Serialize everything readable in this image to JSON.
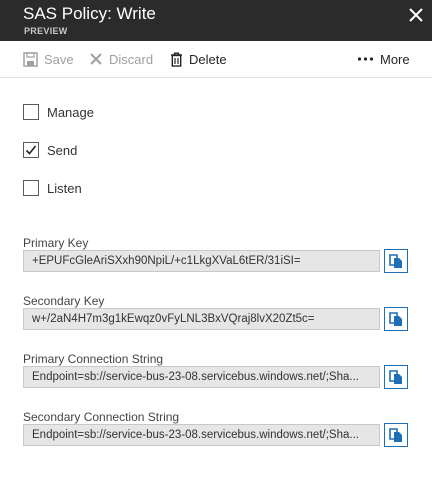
{
  "header": {
    "title": "SAS Policy: Write",
    "subtitle": "PREVIEW"
  },
  "toolbar": {
    "save": "Save",
    "discard": "Discard",
    "delete": "Delete",
    "more": "More"
  },
  "claims": [
    {
      "label": "Manage",
      "checked": false
    },
    {
      "label": "Send",
      "checked": true
    },
    {
      "label": "Listen",
      "checked": false
    }
  ],
  "fields": {
    "primary_key": {
      "label": "Primary Key",
      "value": "+EPUFcGleAriSXxh90NpiL/+c1LkgXVaL6tER/31iSI="
    },
    "secondary_key": {
      "label": "Secondary Key",
      "value": "w+/2aN4H7m3g1kEwqz0vFyLNL3BxVQraj8lvX20Zt5c="
    },
    "primary_conn": {
      "label": "Primary Connection String",
      "value": "Endpoint=sb://service-bus-23-08.servicebus.windows.net/;Sha..."
    },
    "secondary_conn": {
      "label": "Secondary Connection String",
      "value": "Endpoint=sb://service-bus-23-08.servicebus.windows.net/;Sha..."
    }
  },
  "colors": {
    "header_bg": "#2b2b2b",
    "accent": "#1e6fb5"
  }
}
